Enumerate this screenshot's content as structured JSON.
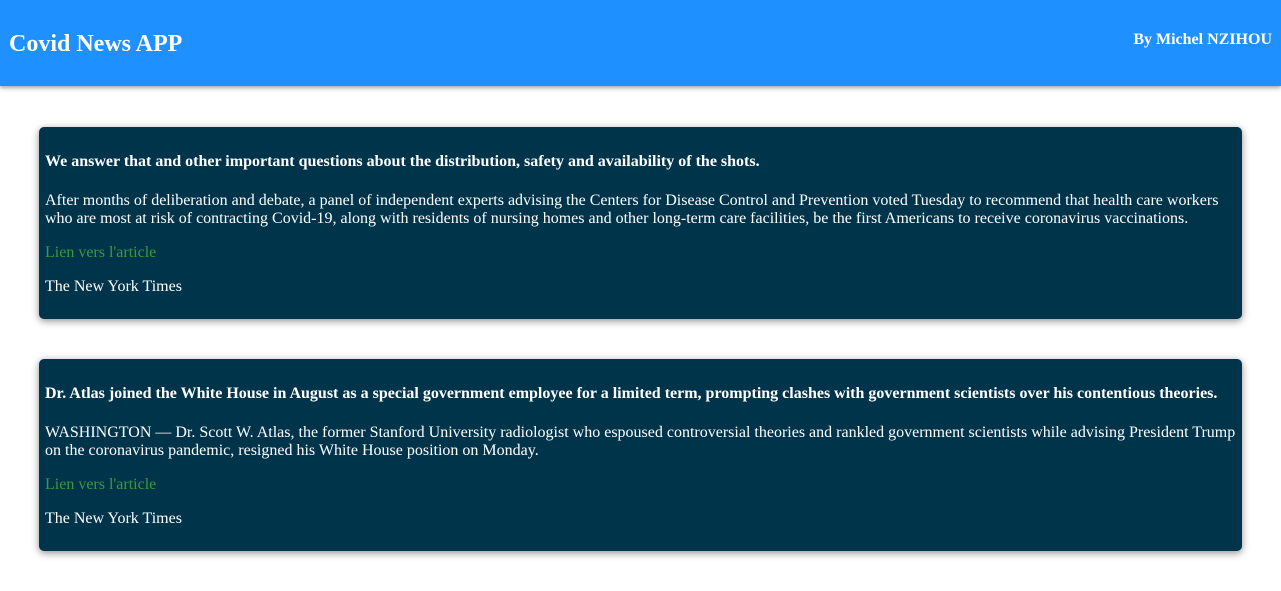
{
  "header": {
    "title": "Covid News APP",
    "author": "By Michel NZIHOU"
  },
  "articles": [
    {
      "title": "We answer that and other important questions about the distribution, safety and availability of the shots.",
      "description": "After months of deliberation and debate, a panel of independent experts advising the Centers for Disease Control and Prevention voted Tuesday to recommend that health care workers who are most at risk of contracting Covid-19, along with residents of nursing homes and other long-term care facilities, be the first Americans to receive coronavirus vaccinations.",
      "link_label": "Lien vers l'article",
      "source": "The New York Times"
    },
    {
      "title": "Dr. Atlas joined the White House in August as a special government employee for a limited term, prompting clashes with government scientists over his contentious theories.",
      "description": "WASHINGTON — Dr. Scott W. Atlas, the former Stanford University radiologist who espoused controversial theories and rankled government scientists while advising President Trump on the coronavirus pandemic, resigned his White House position on Monday.",
      "link_label": "Lien vers l'article",
      "source": "The New York Times"
    }
  ],
  "colors": {
    "header_bg": "#1e90ff",
    "card_bg": "#00344b",
    "link": "#3b9a3b"
  }
}
